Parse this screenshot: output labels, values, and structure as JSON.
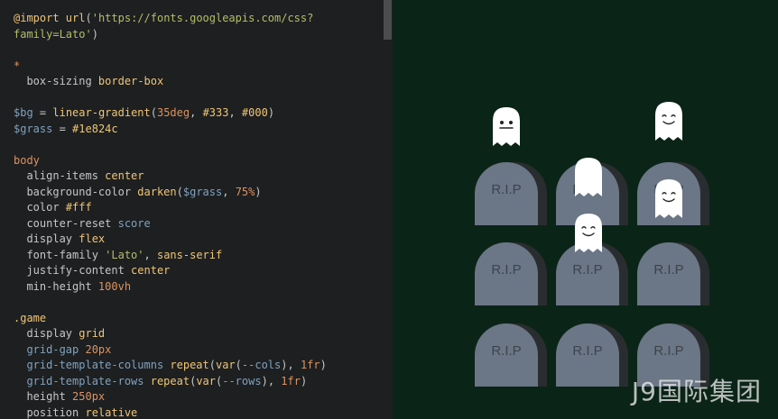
{
  "editor": {
    "lines": [
      [
        {
          "c": "t-val",
          "t": "@import "
        },
        {
          "c": "t-val",
          "t": "url"
        },
        {
          "c": "t-punc",
          "t": "("
        },
        {
          "c": "t-str",
          "t": "'https://fonts.googleapis.com/css?"
        }
      ],
      [
        {
          "c": "t-str",
          "t": "family=Lato'"
        },
        {
          "c": "t-punc",
          "t": ")"
        }
      ],
      [
        {
          "c": "t-punc",
          "t": ""
        }
      ],
      [
        {
          "c": "t-num",
          "t": "*"
        }
      ],
      [
        {
          "c": "t-prop",
          "t": "  box-sizing "
        },
        {
          "c": "t-val",
          "t": "border-box"
        }
      ],
      [
        {
          "c": "t-punc",
          "t": ""
        }
      ],
      [
        {
          "c": "t-var",
          "t": "$bg"
        },
        {
          "c": "t-punc",
          "t": " = "
        },
        {
          "c": "t-val",
          "t": "linear-gradient"
        },
        {
          "c": "t-punc",
          "t": "("
        },
        {
          "c": "t-num",
          "t": "35deg"
        },
        {
          "c": "t-punc",
          "t": ", "
        },
        {
          "c": "t-val",
          "t": "#333"
        },
        {
          "c": "t-punc",
          "t": ", "
        },
        {
          "c": "t-val",
          "t": "#000"
        },
        {
          "c": "t-punc",
          "t": ")"
        }
      ],
      [
        {
          "c": "t-var",
          "t": "$grass"
        },
        {
          "c": "t-punc",
          "t": " = "
        },
        {
          "c": "t-val",
          "t": "#1e824c"
        }
      ],
      [
        {
          "c": "t-punc",
          "t": ""
        }
      ],
      [
        {
          "c": "t-num",
          "t": "body"
        }
      ],
      [
        {
          "c": "t-prop",
          "t": "  align-items "
        },
        {
          "c": "t-val",
          "t": "center"
        }
      ],
      [
        {
          "c": "t-prop",
          "t": "  background-color "
        },
        {
          "c": "t-val",
          "t": "darken"
        },
        {
          "c": "t-punc",
          "t": "("
        },
        {
          "c": "t-var",
          "t": "$grass"
        },
        {
          "c": "t-punc",
          "t": ", "
        },
        {
          "c": "t-num",
          "t": "75%"
        },
        {
          "c": "t-punc",
          "t": ")"
        }
      ],
      [
        {
          "c": "t-prop",
          "t": "  color "
        },
        {
          "c": "t-val",
          "t": "#fff"
        }
      ],
      [
        {
          "c": "t-prop",
          "t": "  counter-reset "
        },
        {
          "c": "t-kw",
          "t": "score"
        }
      ],
      [
        {
          "c": "t-prop",
          "t": "  display "
        },
        {
          "c": "t-val",
          "t": "flex"
        }
      ],
      [
        {
          "c": "t-prop",
          "t": "  font-family "
        },
        {
          "c": "t-str",
          "t": "'Lato'"
        },
        {
          "c": "t-punc",
          "t": ", "
        },
        {
          "c": "t-val",
          "t": "sans-serif"
        }
      ],
      [
        {
          "c": "t-prop",
          "t": "  justify-content "
        },
        {
          "c": "t-val",
          "t": "center"
        }
      ],
      [
        {
          "c": "t-prop",
          "t": "  min-height "
        },
        {
          "c": "t-num",
          "t": "100vh"
        }
      ],
      [
        {
          "c": "t-punc",
          "t": ""
        }
      ],
      [
        {
          "c": "t-cls",
          "t": ".game"
        }
      ],
      [
        {
          "c": "t-prop",
          "t": "  display "
        },
        {
          "c": "t-val",
          "t": "grid"
        }
      ],
      [
        {
          "c": "t-kw",
          "t": "  grid-gap "
        },
        {
          "c": "t-num",
          "t": "20px"
        }
      ],
      [
        {
          "c": "t-kw",
          "t": "  grid-template-columns "
        },
        {
          "c": "t-val",
          "t": "repeat"
        },
        {
          "c": "t-punc",
          "t": "("
        },
        {
          "c": "t-val",
          "t": "var"
        },
        {
          "c": "t-punc",
          "t": "("
        },
        {
          "c": "t-var",
          "t": "--cols"
        },
        {
          "c": "t-punc",
          "t": "), "
        },
        {
          "c": "t-num",
          "t": "1fr"
        },
        {
          "c": "t-punc",
          "t": ")"
        }
      ],
      [
        {
          "c": "t-kw",
          "t": "  grid-template-rows "
        },
        {
          "c": "t-val",
          "t": "repeat"
        },
        {
          "c": "t-punc",
          "t": "("
        },
        {
          "c": "t-val",
          "t": "var"
        },
        {
          "c": "t-punc",
          "t": "("
        },
        {
          "c": "t-var",
          "t": "--rows"
        },
        {
          "c": "t-punc",
          "t": "), "
        },
        {
          "c": "t-num",
          "t": "1fr"
        },
        {
          "c": "t-punc",
          "t": ")"
        }
      ],
      [
        {
          "c": "t-prop",
          "t": "  height "
        },
        {
          "c": "t-num",
          "t": "250px"
        }
      ],
      [
        {
          "c": "t-prop",
          "t": "  position "
        },
        {
          "c": "t-val",
          "t": "relative"
        }
      ]
    ]
  },
  "game": {
    "tombstone_label": "R.I.P",
    "tombstones": [
      {
        "id": "1"
      },
      {
        "id": "2"
      },
      {
        "id": "3"
      },
      {
        "id": "4"
      },
      {
        "id": "5"
      },
      {
        "id": "6"
      },
      {
        "id": "7"
      },
      {
        "id": "8"
      },
      {
        "id": "9"
      }
    ],
    "ghosts": [
      {
        "mood": "flat"
      },
      {
        "mood": "smile"
      },
      {
        "mood": "peek"
      },
      {
        "mood": "smile"
      },
      {
        "mood": "smile"
      }
    ]
  },
  "watermark": "J9国际集团",
  "colors": {
    "editor_bg": "#1d1f21",
    "preview_bg": "#0b2418",
    "tombstone": "#6b7686",
    "tombstone_shadow": "#2a2d2f",
    "ghost": "#ffffff"
  }
}
